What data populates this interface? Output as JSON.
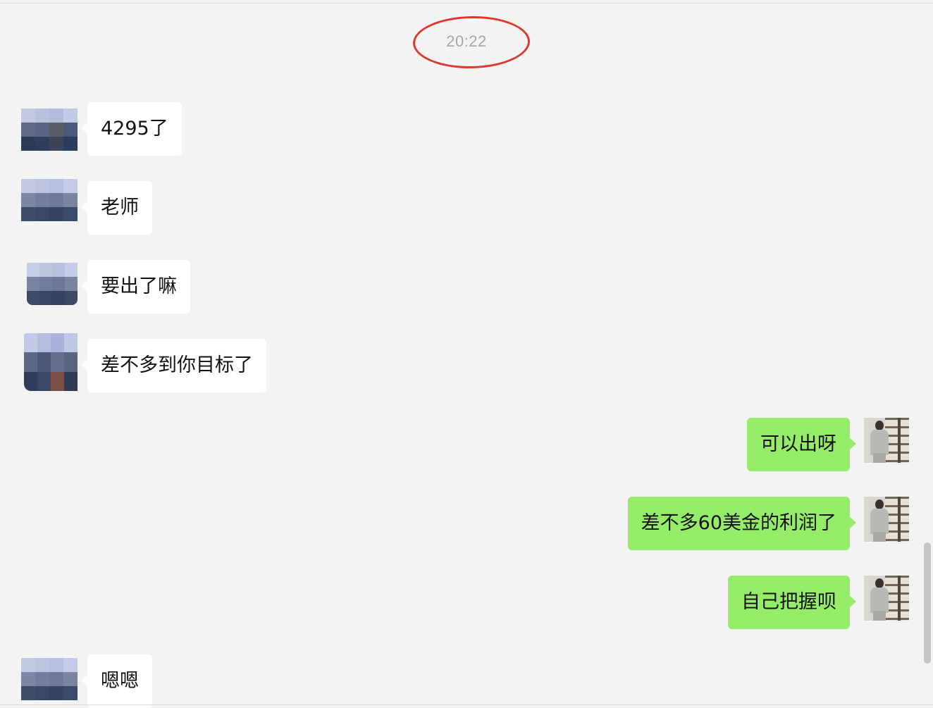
{
  "chat": {
    "timestamp": "20:22",
    "messages": [
      {
        "sender": "other",
        "text": "4295了"
      },
      {
        "sender": "other",
        "text": "老师"
      },
      {
        "sender": "other",
        "text": "要出了嘛"
      },
      {
        "sender": "other",
        "text": "差不多到你目标了"
      },
      {
        "sender": "me",
        "text": "可以出呀"
      },
      {
        "sender": "me",
        "text": "差不多60美金的利润了"
      },
      {
        "sender": "me",
        "text": "自己把握呗"
      },
      {
        "sender": "other",
        "text": "嗯嗯"
      }
    ]
  },
  "colors": {
    "background": "#f3f3f3",
    "incoming_bubble": "#ffffff",
    "outgoing_bubble": "#95ec69",
    "highlight_circle": "#e0382c",
    "timestamp_text": "#a7a7a7"
  },
  "icons": {
    "other_avatar": "pixelated-avatar-icon",
    "my_avatar": "person-photo-avatar-icon"
  }
}
